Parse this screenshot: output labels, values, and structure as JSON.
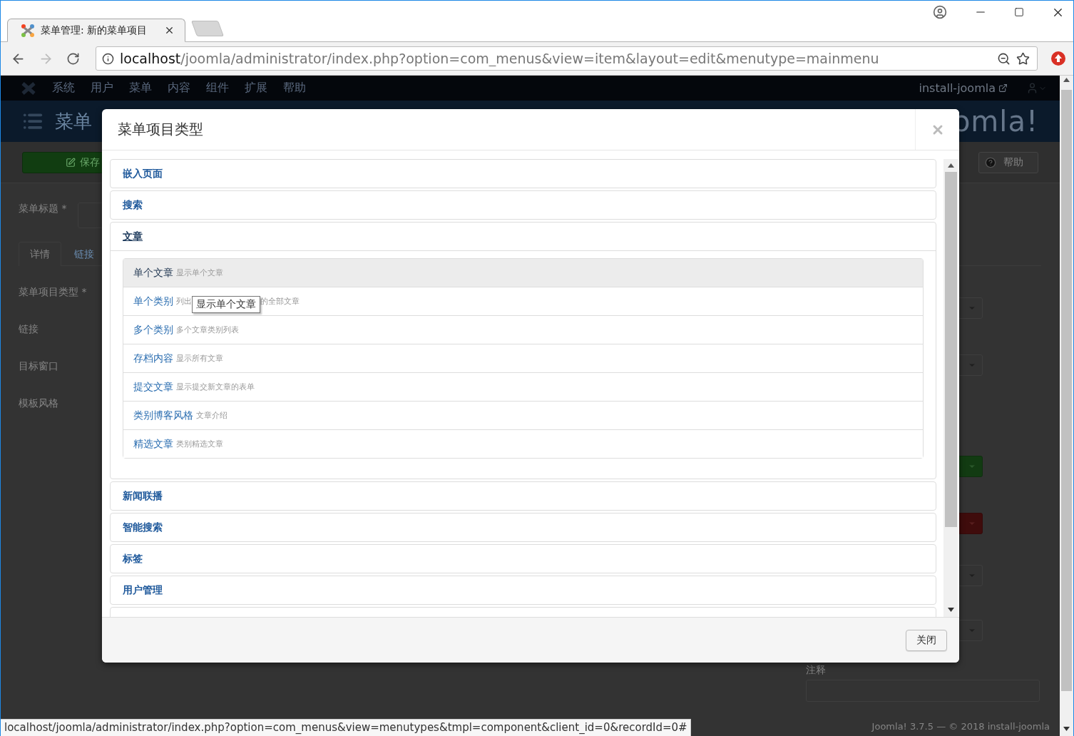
{
  "browser": {
    "tab": {
      "title": "菜单管理: 新的菜单项目",
      "selected": true
    },
    "forward_enabled": false,
    "address": {
      "host": "localhost",
      "path": "/joomla/administrator/index.php?option=com_menus&view=item&layout=edit&menutype=mainmenu"
    }
  },
  "admin": {
    "nav_items": [
      "系统",
      "用户",
      "菜单",
      "内容",
      "组件",
      "扩展",
      "帮助"
    ],
    "site_link": "install-joomla",
    "page_title": "菜单",
    "logo_text": "omla!",
    "save_button": "保存",
    "help_button": "帮助",
    "title_label": "菜单标题 *",
    "tabs": [
      {
        "label": "详情",
        "selected": true
      },
      {
        "label": "链接",
        "selected": false
      }
    ],
    "form_labels": [
      "菜单项目类型 *",
      "链接",
      "目标窗口",
      "模板风格"
    ],
    "right_controls": [
      {
        "kind": "select"
      },
      {
        "kind": "select"
      },
      {
        "kind": "success"
      },
      {
        "kind": "danger"
      },
      {
        "kind": "select"
      },
      {
        "kind": "select"
      }
    ],
    "notes_label": "注释",
    "footer": "Joomla! 3.7.5 — © 2018 install-joomla"
  },
  "modal": {
    "title": "菜单项目类型",
    "groups": [
      {
        "label": "嵌入页面",
        "expanded": false
      },
      {
        "label": "搜索",
        "expanded": false
      },
      {
        "label": "文章",
        "expanded": true,
        "items": [
          {
            "name": "单个文章",
            "description": "显示单个文章",
            "highlighted": true
          },
          {
            "name": "单个类别",
            "description": "列出",
            "tooltip": "显示单个文章",
            "description_after": "的全部文章",
            "highlighted": false
          },
          {
            "name": "多个类别",
            "description": "多个文章类别列表",
            "highlighted": false
          },
          {
            "name": "存档内容",
            "description": "显示所有文章",
            "highlighted": false
          },
          {
            "name": "提交文章",
            "description": "显示提交新文章的表单",
            "highlighted": false
          },
          {
            "name": "类别博客风格",
            "description": "文章介绍",
            "highlighted": false
          },
          {
            "name": "精选文章",
            "description": "类别精选文章",
            "highlighted": false
          }
        ]
      },
      {
        "label": "新闻联播",
        "expanded": false
      },
      {
        "label": "智能搜索",
        "expanded": false
      },
      {
        "label": "标签",
        "expanded": false
      },
      {
        "label": "用户管理",
        "expanded": false
      },
      {
        "expanded": false
      }
    ],
    "close_button": "关闭"
  },
  "status_url": "localhost/joomla/administrator/index.php?option=com_menus&view=menutypes&tmpl=component&client_id=0&recordId=0#"
}
